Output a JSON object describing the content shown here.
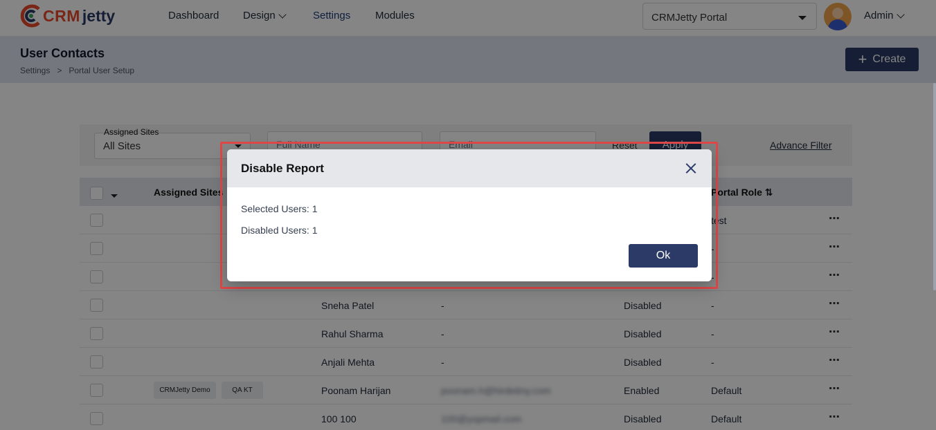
{
  "nav": {
    "brand_part1": "CRM",
    "brand_part2": "jetty",
    "items": [
      "Dashboard",
      "Design",
      "Settings",
      "Modules"
    ],
    "portal_select": "CRMJetty Portal",
    "user": "Admin"
  },
  "header": {
    "title": "User Contacts",
    "breadcrumb": [
      "Settings",
      ">",
      "Portal User Setup"
    ],
    "create_label": "Create"
  },
  "filters": {
    "assigned_sites_label": "Assigned Sites",
    "assigned_sites_value": "All Sites",
    "full_name_placeholder": "Full Name",
    "email_placeholder": "Email",
    "reset_label": "Reset",
    "apply_label": "Apply",
    "advance_filter_label": "Advance Filter"
  },
  "table": {
    "columns": {
      "assigned_sites": "Assigned Sites",
      "portal_role": "Portal Role ⇅"
    },
    "rows": [
      {
        "name": "",
        "email": "",
        "status": "",
        "role": "test",
        "chips": []
      },
      {
        "name": "",
        "email": "",
        "status": "",
        "role": "-",
        "chips": []
      },
      {
        "name": "",
        "email": "",
        "status": "",
        "role": "-",
        "chips": []
      },
      {
        "name": "Sneha Patel",
        "email": "-",
        "status": "Disabled",
        "role": "-",
        "chips": []
      },
      {
        "name": "Rahul Sharma",
        "email": "-",
        "status": "Disabled",
        "role": "-",
        "chips": []
      },
      {
        "name": "Anjali Mehta",
        "email": "-",
        "status": "Disabled",
        "role": "-",
        "chips": []
      },
      {
        "name": "Poonam Harijan",
        "email": "poonam.h@hirdetiny.com",
        "status": "Enabled",
        "role": "Default",
        "chips": [
          "CRMJetty Demo",
          "QA KT"
        ]
      },
      {
        "name": "100 100",
        "email": "100@yopmail.com",
        "status": "Disabled",
        "role": "Default",
        "chips": []
      }
    ],
    "actions_label": "⋯"
  },
  "modal": {
    "title": "Disable Report",
    "selected_users": "Selected Users: 1",
    "disabled_users": "Disabled Users: 1",
    "ok_label": "Ok"
  },
  "colors": {
    "primary": "#2b3a67",
    "accent": "#e8492b",
    "highlight": "#e04848"
  }
}
